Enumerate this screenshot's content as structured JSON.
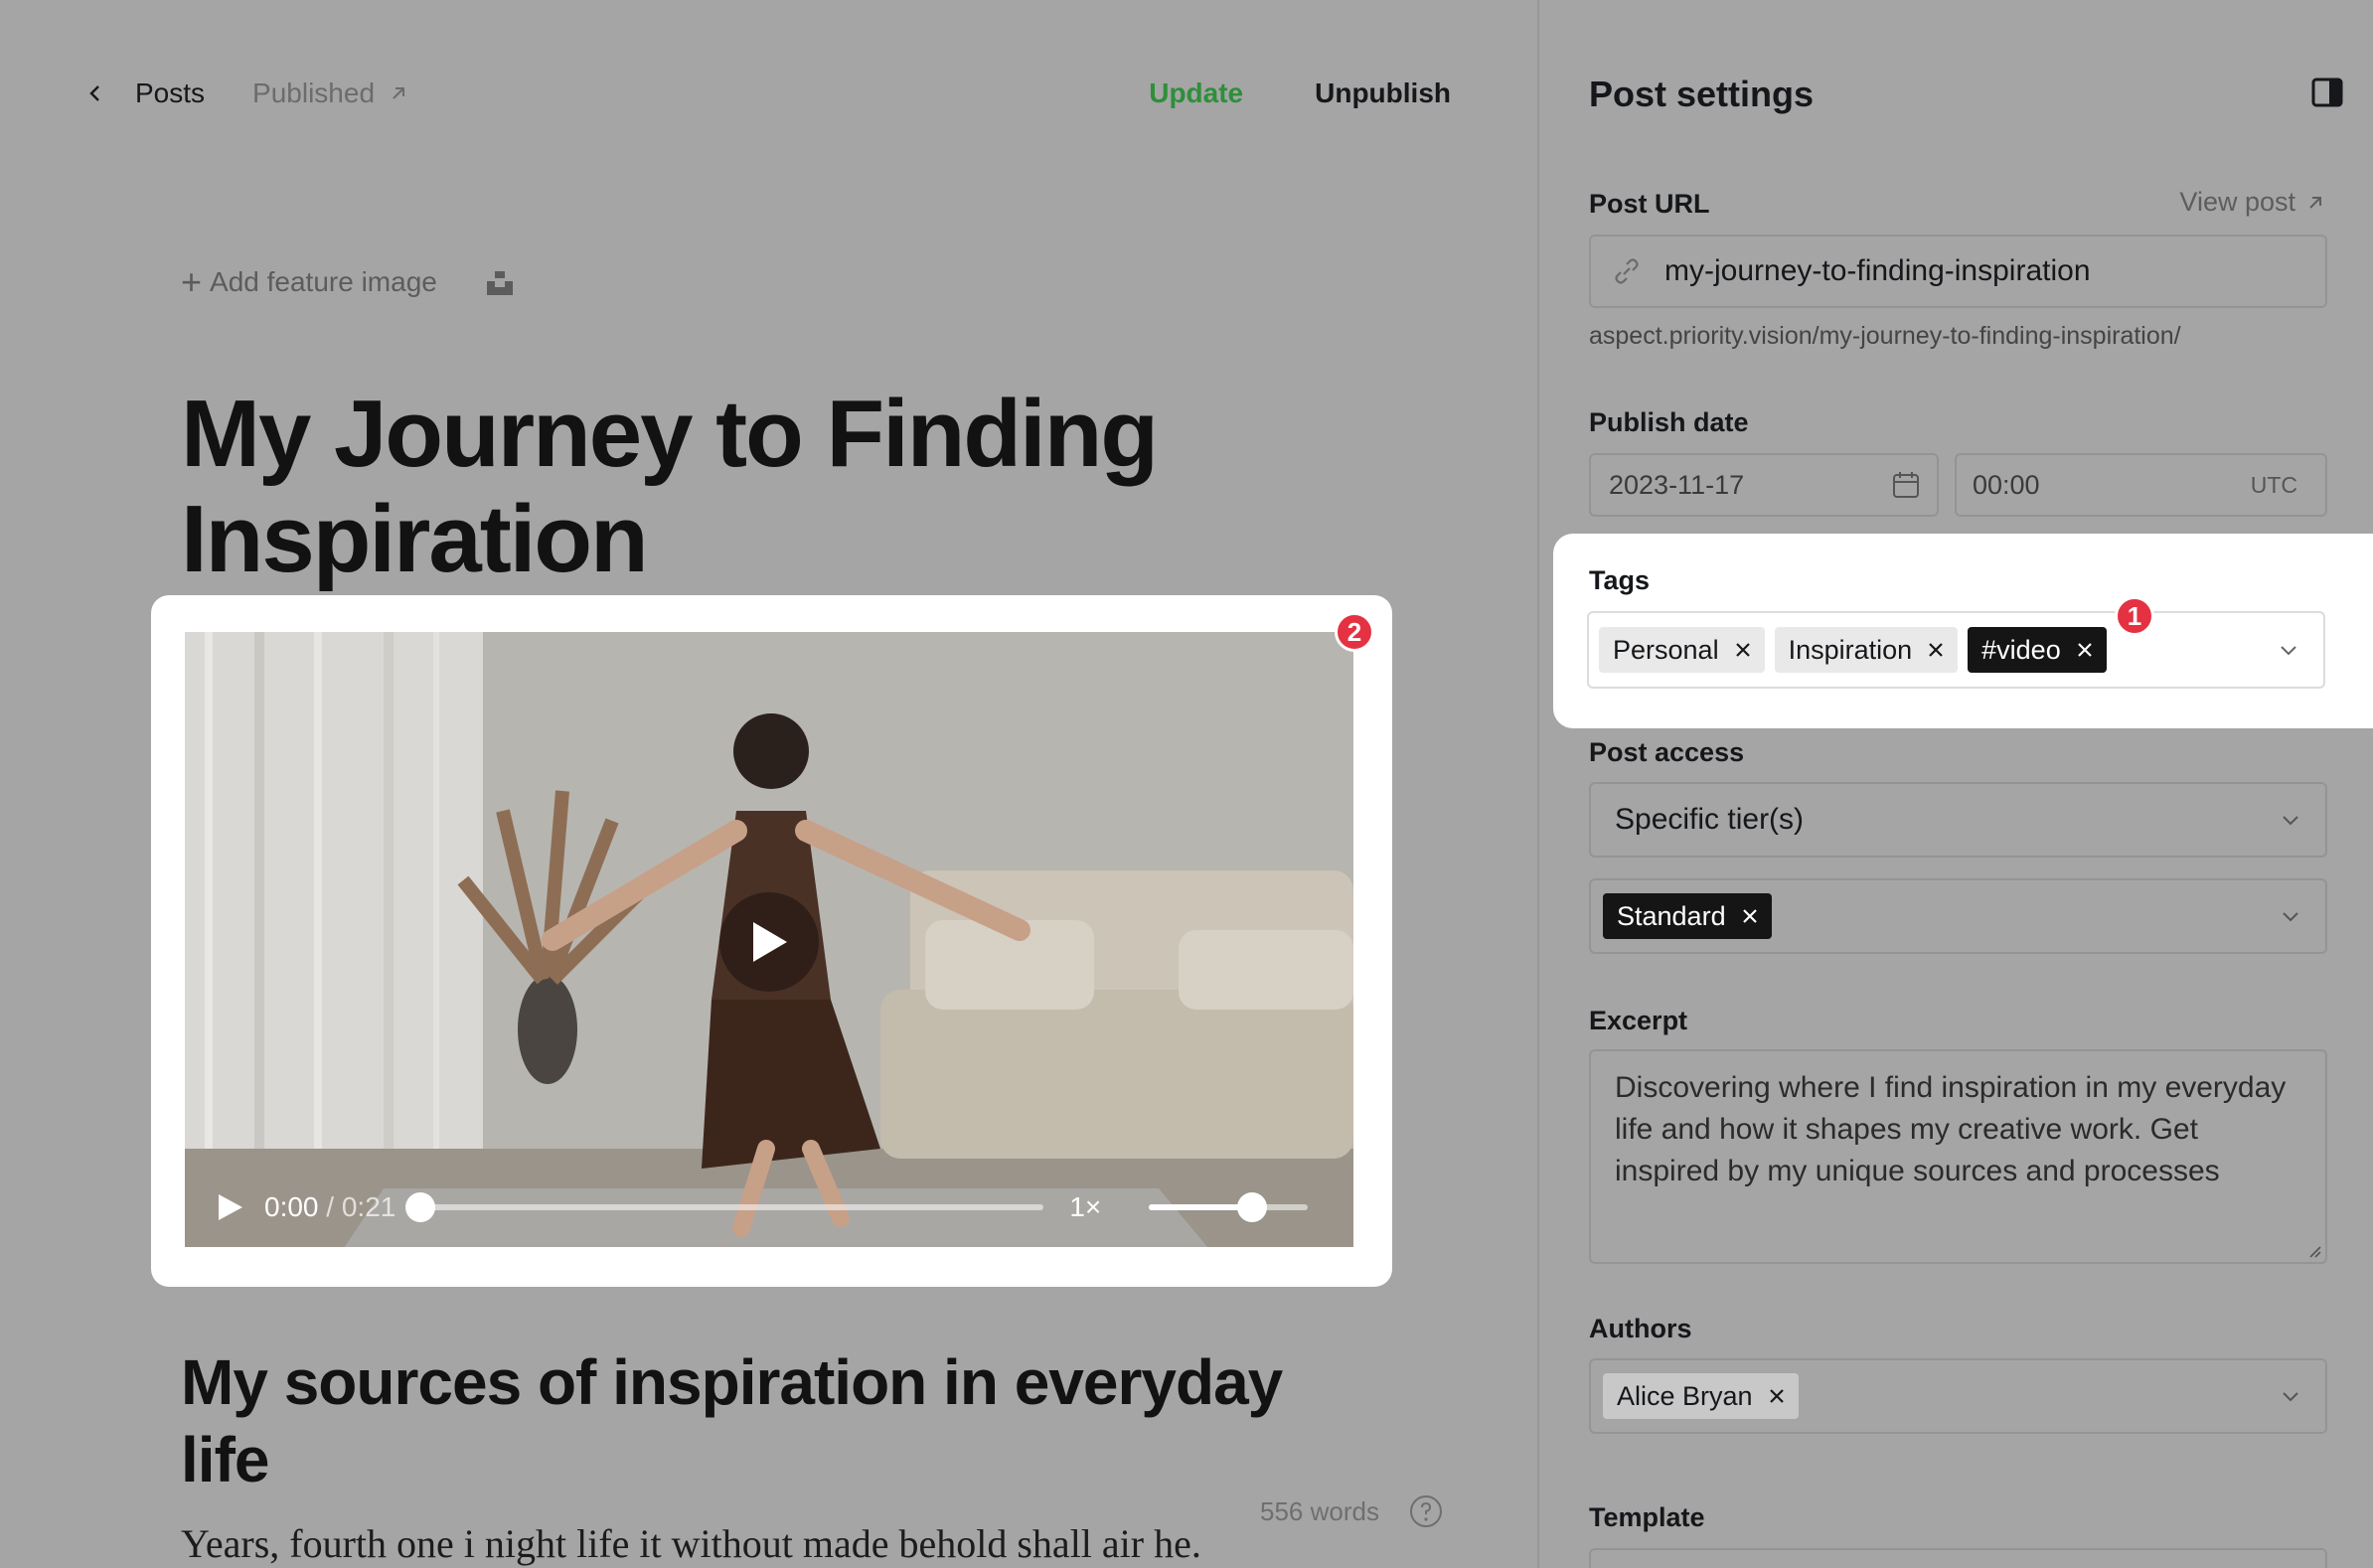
{
  "header": {
    "back_label": "Posts",
    "status_label": "Published",
    "update_label": "Update",
    "unpublish_label": "Unpublish"
  },
  "editor": {
    "add_feature_image_label": "Add feature image",
    "title_line1": "My Journey to Finding",
    "title_line2": "Inspiration",
    "subheading_line1": "My sources of inspiration in everyday",
    "subheading_line2": "life",
    "body_text": "Years, fourth one i night life it without made behold shall air he.",
    "word_count": "556 words"
  },
  "video": {
    "current_time": "0:00",
    "separator": "/",
    "duration": "0:21",
    "speed": "1×",
    "progress": 0.0,
    "volume": 0.65
  },
  "badges": {
    "one": "1",
    "two": "2"
  },
  "settings": {
    "title": "Post settings",
    "post_url": {
      "label": "Post URL",
      "view_post_label": "View post",
      "value": "my-journey-to-finding-inspiration",
      "hint": "aspect.priority.vision/my-journey-to-finding-inspiration/"
    },
    "publish_date": {
      "label": "Publish date",
      "date": "2023-11-17",
      "time": "00:00",
      "timezone": "UTC"
    },
    "tags": {
      "label": "Tags",
      "items": [
        "Personal",
        "Inspiration",
        "#video"
      ]
    },
    "post_access": {
      "label": "Post access",
      "selected": "Specific tier(s)",
      "tiers": [
        "Standard"
      ]
    },
    "excerpt": {
      "label": "Excerpt",
      "value": "Discovering where I find inspiration in my everyday life and how it shapes my creative work. Get inspired by my unique sources and processes"
    },
    "authors": {
      "label": "Authors",
      "items": [
        "Alice Bryan"
      ]
    },
    "template": {
      "label": "Template"
    }
  },
  "colors": {
    "accent_green": "#2e8f3a",
    "badge_red": "#e53242",
    "overlay_gray": "#a5a5a5"
  }
}
